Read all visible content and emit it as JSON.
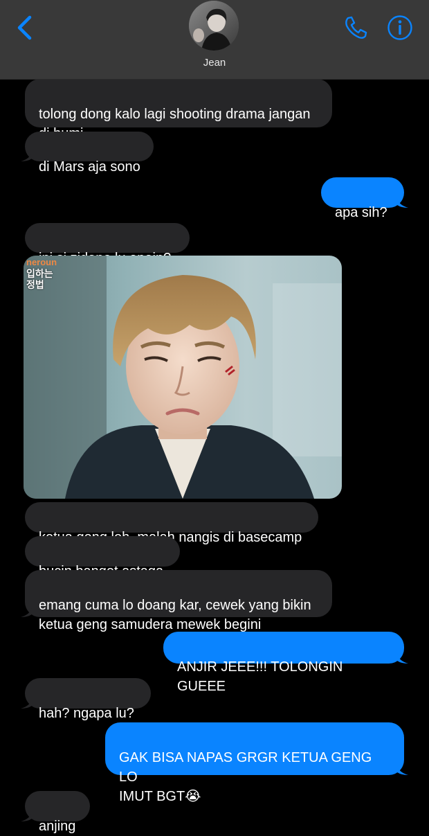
{
  "header": {
    "contact_name": "Jean",
    "back_icon": "chevron-left-icon",
    "call_icon": "phone-icon",
    "info_icon": "info-icon",
    "accent_color": "#0a84ff"
  },
  "messages": [
    {
      "side": "received",
      "text": "tolong dong kalo lagi shooting drama jangan\ndi bumi"
    },
    {
      "side": "received",
      "text": "di Mars aja sono"
    },
    {
      "side": "sent",
      "text": "apa sih?"
    },
    {
      "side": "received",
      "text": "ini si zidane lu apain?"
    },
    {
      "side": "received",
      "type": "image",
      "watermark": "neroun",
      "caption_overlay": "입하는\n정법"
    },
    {
      "side": "received",
      "text": "ketua geng loh, malah nangis di basecamp"
    },
    {
      "side": "received",
      "text": "bucin banget astaga"
    },
    {
      "side": "received",
      "text": "emang cuma lo doang kar, cewek yang bikin\nketua geng samudera mewek begini"
    },
    {
      "side": "sent",
      "text": "ANJIR JEEE!!! TOLONGIN GUEEE"
    },
    {
      "side": "received",
      "text": "hah? ngapa lu?"
    },
    {
      "side": "sent",
      "text": "GAK BISA NAPAS GRGR KETUA GENG LO\nIMUT BGT😭"
    },
    {
      "side": "received",
      "text": "anjing"
    }
  ],
  "colors": {
    "received_bubble": "#262628",
    "sent_bubble": "#0a84ff",
    "background": "#000000",
    "header_bg": "#393939"
  }
}
